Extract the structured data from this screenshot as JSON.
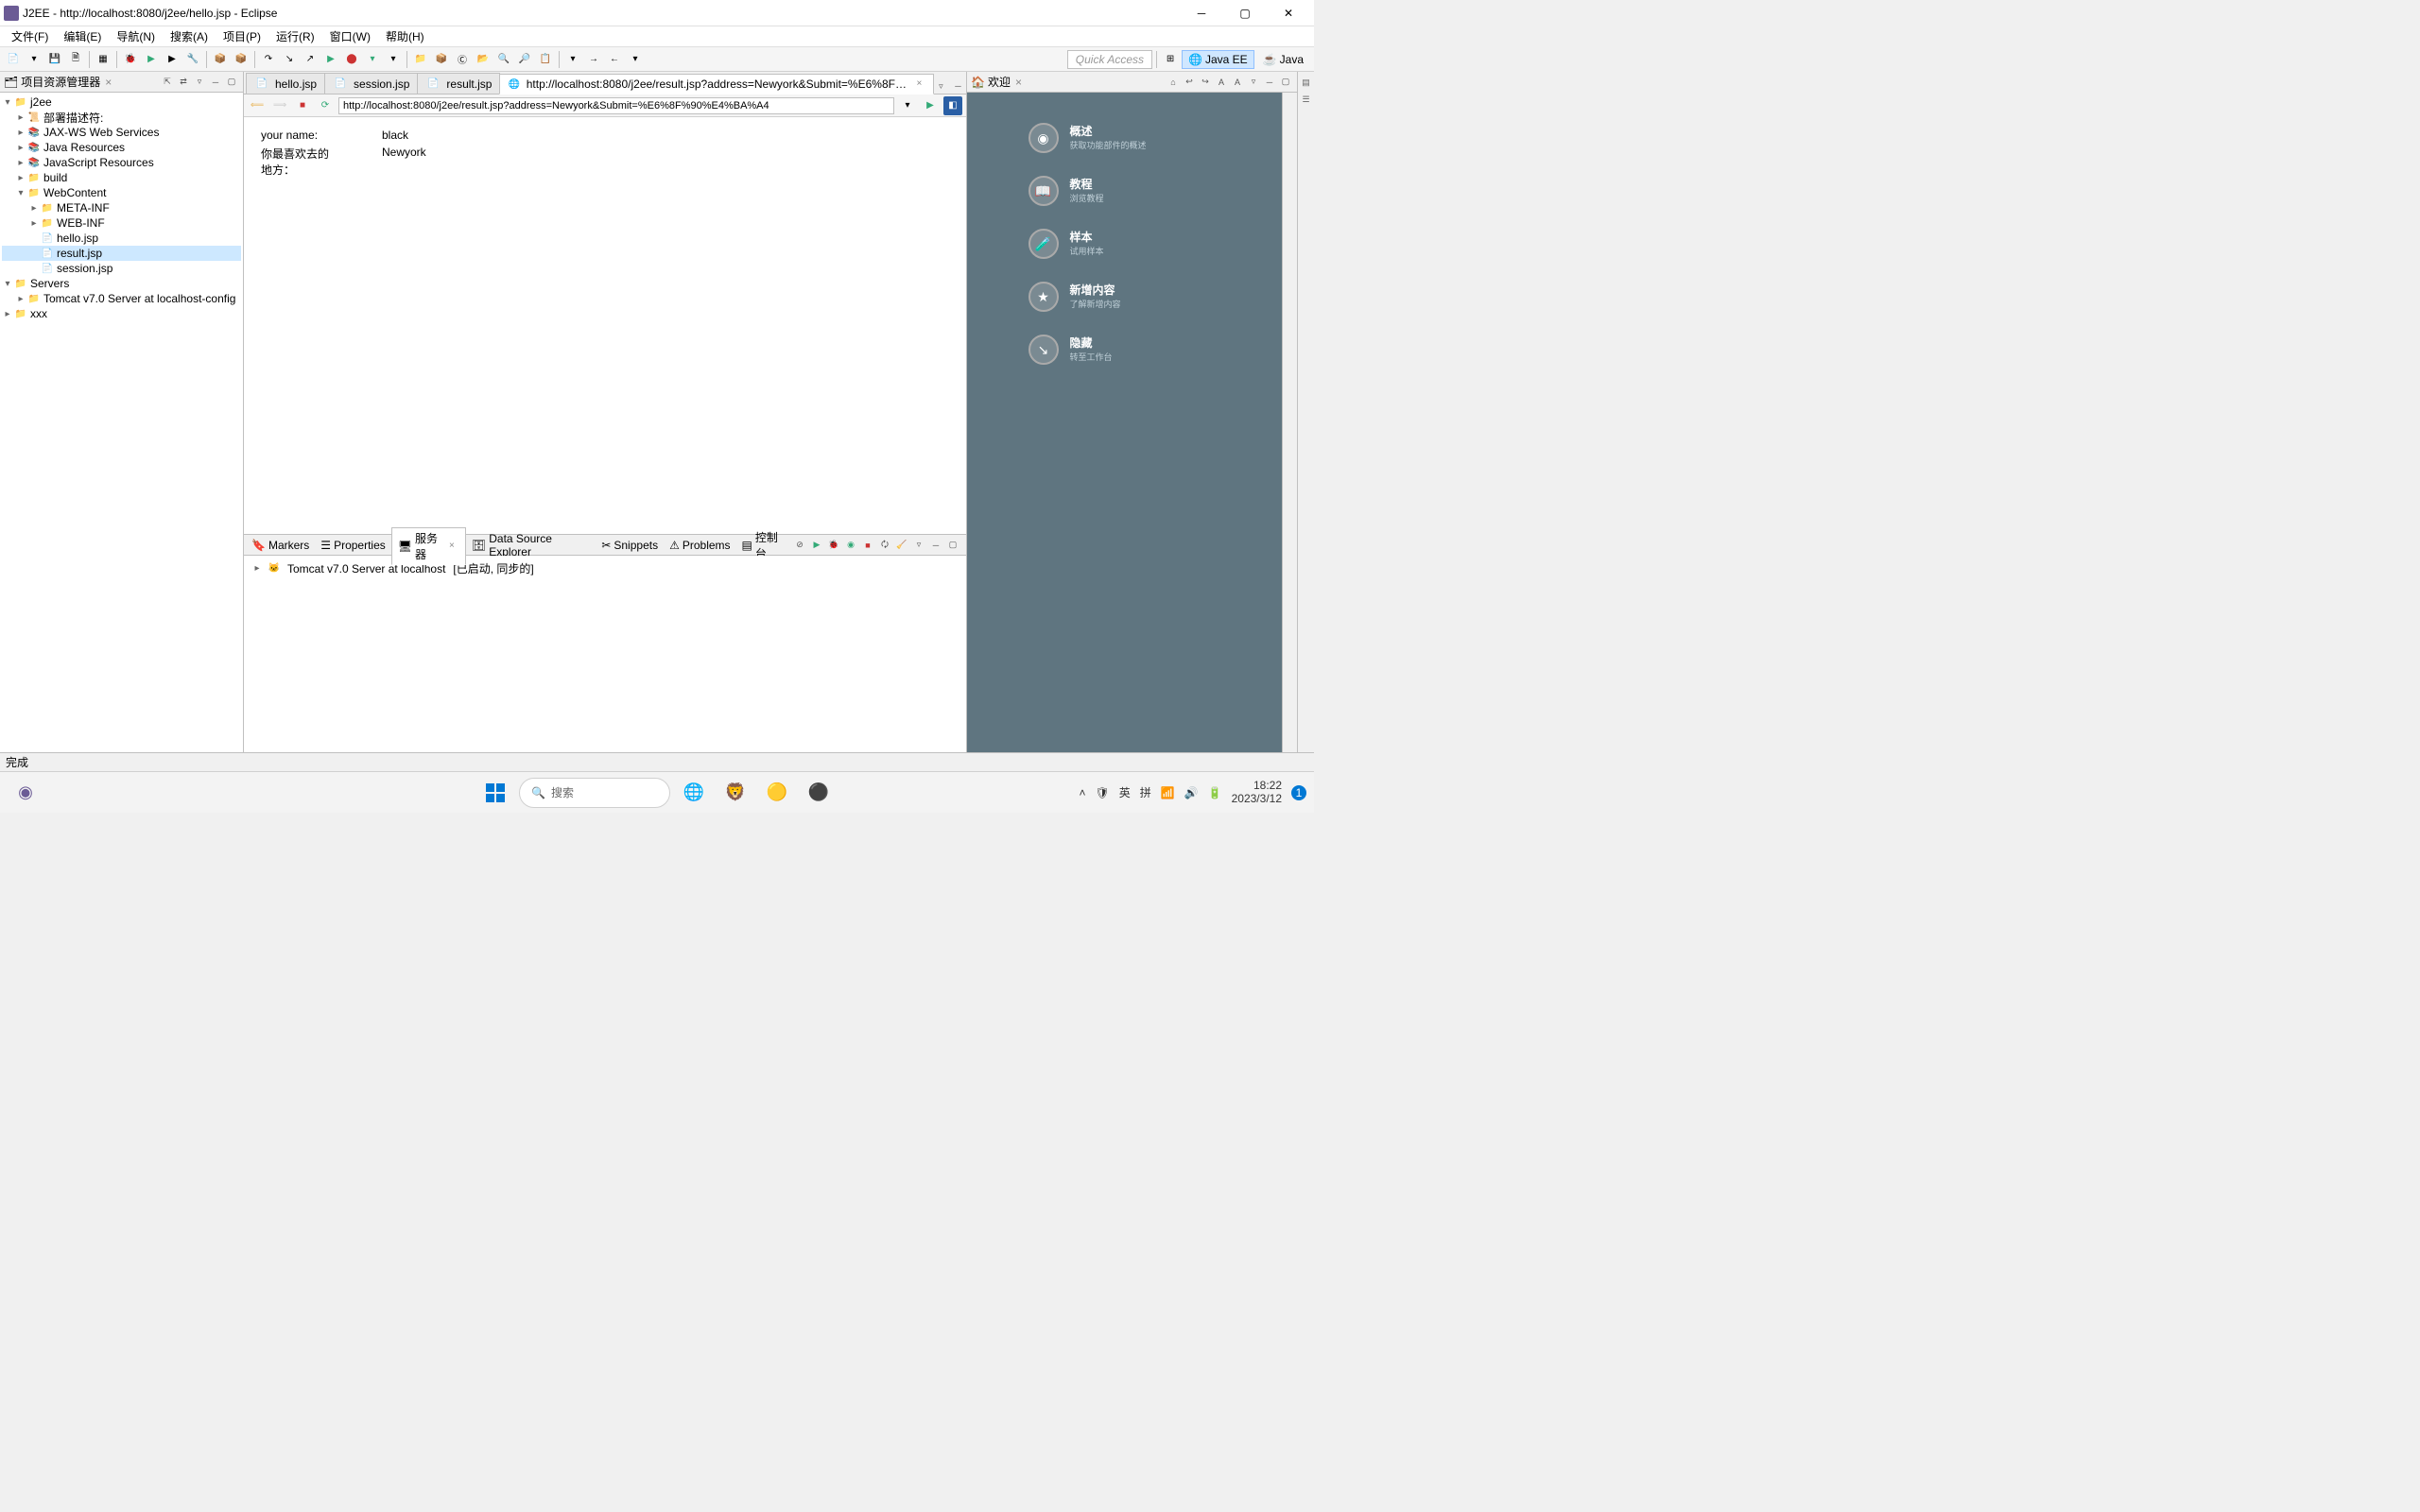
{
  "window": {
    "title": "J2EE - http://localhost:8080/j2ee/hello.jsp - Eclipse"
  },
  "menubar": [
    "文件(F)",
    "编辑(E)",
    "导航(N)",
    "搜索(A)",
    "项目(P)",
    "运行(R)",
    "窗口(W)",
    "帮助(H)"
  ],
  "quick_access": "Quick Access",
  "perspectives": {
    "javaee": "Java EE",
    "java": "Java"
  },
  "project_explorer": {
    "title": "项目资源管理器",
    "tree": {
      "j2ee": "j2ee",
      "deploy": "部署描述符:",
      "jaxws": "JAX-WS Web Services",
      "javares": "Java Resources",
      "jsres": "JavaScript Resources",
      "build": "build",
      "webcontent": "WebContent",
      "metainf": "META-INF",
      "webinf": "WEB-INF",
      "hellojsp": "hello.jsp",
      "resultjsp": "result.jsp",
      "sessionjsp": "session.jsp",
      "servers": "Servers",
      "tomcatcfg": "Tomcat v7.0 Server at localhost-config",
      "xxx": "xxx"
    }
  },
  "editor": {
    "tabs": {
      "hello": "hello.jsp",
      "session": "session.jsp",
      "result": "result.jsp",
      "browser": "http://localhost:8080/j2ee/result.jsp?address=Newyork&Submit=%E6%8F%90%E4%BA%A4"
    },
    "url": "http://localhost:8080/j2ee/result.jsp?address=Newyork&Submit=%E6%8F%90%E4%BA%A4",
    "page": {
      "name_label": "your name:",
      "name_value": "black",
      "place_label": "你最喜欢去的地方：",
      "place_value": "Newyork"
    }
  },
  "bottom": {
    "tabs": {
      "markers": "Markers",
      "properties": "Properties",
      "servers": "服务器",
      "dse": "Data Source Explorer",
      "snippets": "Snippets",
      "problems": "Problems",
      "console": "控制台"
    },
    "server_name": "Tomcat v7.0 Server at localhost",
    "server_state": "[已启动, 同步的]"
  },
  "welcome": {
    "tab": "欢迎",
    "items": [
      {
        "title": "概述",
        "sub": "获取功能部件的概述"
      },
      {
        "title": "教程",
        "sub": "浏览教程"
      },
      {
        "title": "样本",
        "sub": "试用样本"
      },
      {
        "title": "新增内容",
        "sub": "了解新增内容"
      },
      {
        "title": "隐藏",
        "sub": "转至工作台"
      }
    ]
  },
  "statusbar": {
    "text": "完成"
  },
  "taskbar": {
    "search": "搜索",
    "ime_lang": "英",
    "ime_mode": "拼",
    "time": "18:22",
    "date": "2023/3/12"
  }
}
